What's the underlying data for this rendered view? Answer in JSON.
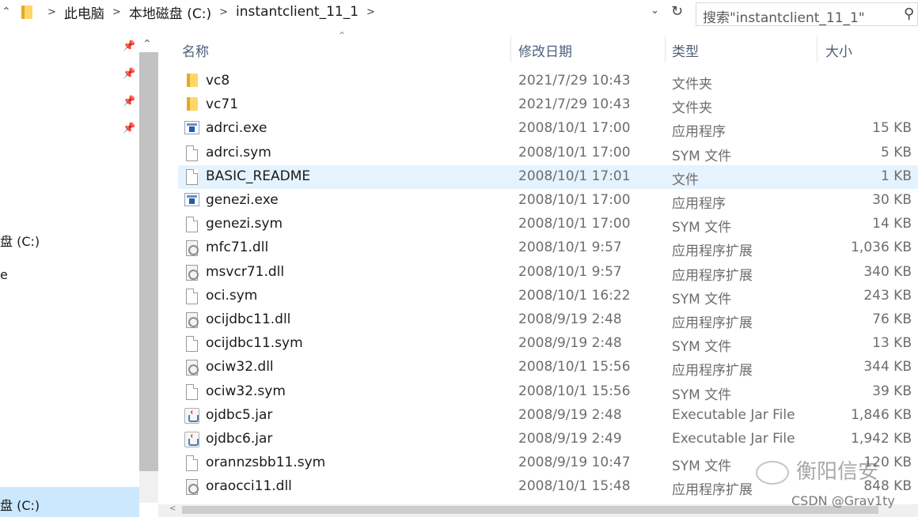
{
  "address_bar": {
    "crumbs": [
      "此电脑",
      "本地磁盘 (C:)",
      "instantclient_11_1"
    ],
    "search_placeholder": "搜索\"instantclient_11_1\""
  },
  "nav": {
    "items": [
      "盘 (C:)",
      "e",
      "盘 (C:)"
    ]
  },
  "columns": {
    "name": "名称",
    "date": "修改日期",
    "type": "类型",
    "size": "大小"
  },
  "files": [
    {
      "name": "vc8",
      "date": "2021/7/29 10:43",
      "type": "文件夹",
      "size": "",
      "icon": "folder-icon"
    },
    {
      "name": "vc71",
      "date": "2021/7/29 10:43",
      "type": "文件夹",
      "size": "",
      "icon": "folder-icon"
    },
    {
      "name": "adrci.exe",
      "date": "2008/10/1 17:00",
      "type": "应用程序",
      "size": "15 KB",
      "icon": "exe-icon"
    },
    {
      "name": "adrci.sym",
      "date": "2008/10/1 17:00",
      "type": "SYM 文件",
      "size": "5 KB",
      "icon": "file-icon"
    },
    {
      "name": "BASIC_README",
      "date": "2008/10/1 17:01",
      "type": "文件",
      "size": "1 KB",
      "icon": "file-icon"
    },
    {
      "name": "genezi.exe",
      "date": "2008/10/1 17:00",
      "type": "应用程序",
      "size": "30 KB",
      "icon": "exe-icon"
    },
    {
      "name": "genezi.sym",
      "date": "2008/10/1 17:00",
      "type": "SYM 文件",
      "size": "14 KB",
      "icon": "file-icon"
    },
    {
      "name": "mfc71.dll",
      "date": "2008/10/1 9:57",
      "type": "应用程序扩展",
      "size": "1,036 KB",
      "icon": "dll-icon"
    },
    {
      "name": "msvcr71.dll",
      "date": "2008/10/1 9:57",
      "type": "应用程序扩展",
      "size": "340 KB",
      "icon": "dll-icon"
    },
    {
      "name": "oci.sym",
      "date": "2008/10/1 16:22",
      "type": "SYM 文件",
      "size": "243 KB",
      "icon": "file-icon"
    },
    {
      "name": "ocijdbc11.dll",
      "date": "2008/9/19 2:48",
      "type": "应用程序扩展",
      "size": "76 KB",
      "icon": "dll-icon"
    },
    {
      "name": "ocijdbc11.sym",
      "date": "2008/9/19 2:48",
      "type": "SYM 文件",
      "size": "13 KB",
      "icon": "file-icon"
    },
    {
      "name": "ociw32.dll",
      "date": "2008/10/1 15:56",
      "type": "应用程序扩展",
      "size": "344 KB",
      "icon": "dll-icon"
    },
    {
      "name": "ociw32.sym",
      "date": "2008/10/1 15:56",
      "type": "SYM 文件",
      "size": "39 KB",
      "icon": "file-icon"
    },
    {
      "name": "ojdbc5.jar",
      "date": "2008/9/19 2:48",
      "type": "Executable Jar File",
      "size": "1,846 KB",
      "icon": "jar-icon"
    },
    {
      "name": "ojdbc6.jar",
      "date": "2008/9/19 2:49",
      "type": "Executable Jar File",
      "size": "1,942 KB",
      "icon": "jar-icon"
    },
    {
      "name": "orannzsbb11.sym",
      "date": "2008/9/19 10:47",
      "type": "SYM 文件",
      "size": "120 KB",
      "icon": "file-icon"
    },
    {
      "name": "oraocci11.dll",
      "date": "2008/10/1 15:48",
      "type": "应用程序扩展",
      "size": "848 KB",
      "icon": "dll-icon"
    }
  ],
  "selected_row": "BASIC_README",
  "watermark": {
    "text": "衡阳信安",
    "source": "CSDN @Grav1ty"
  }
}
